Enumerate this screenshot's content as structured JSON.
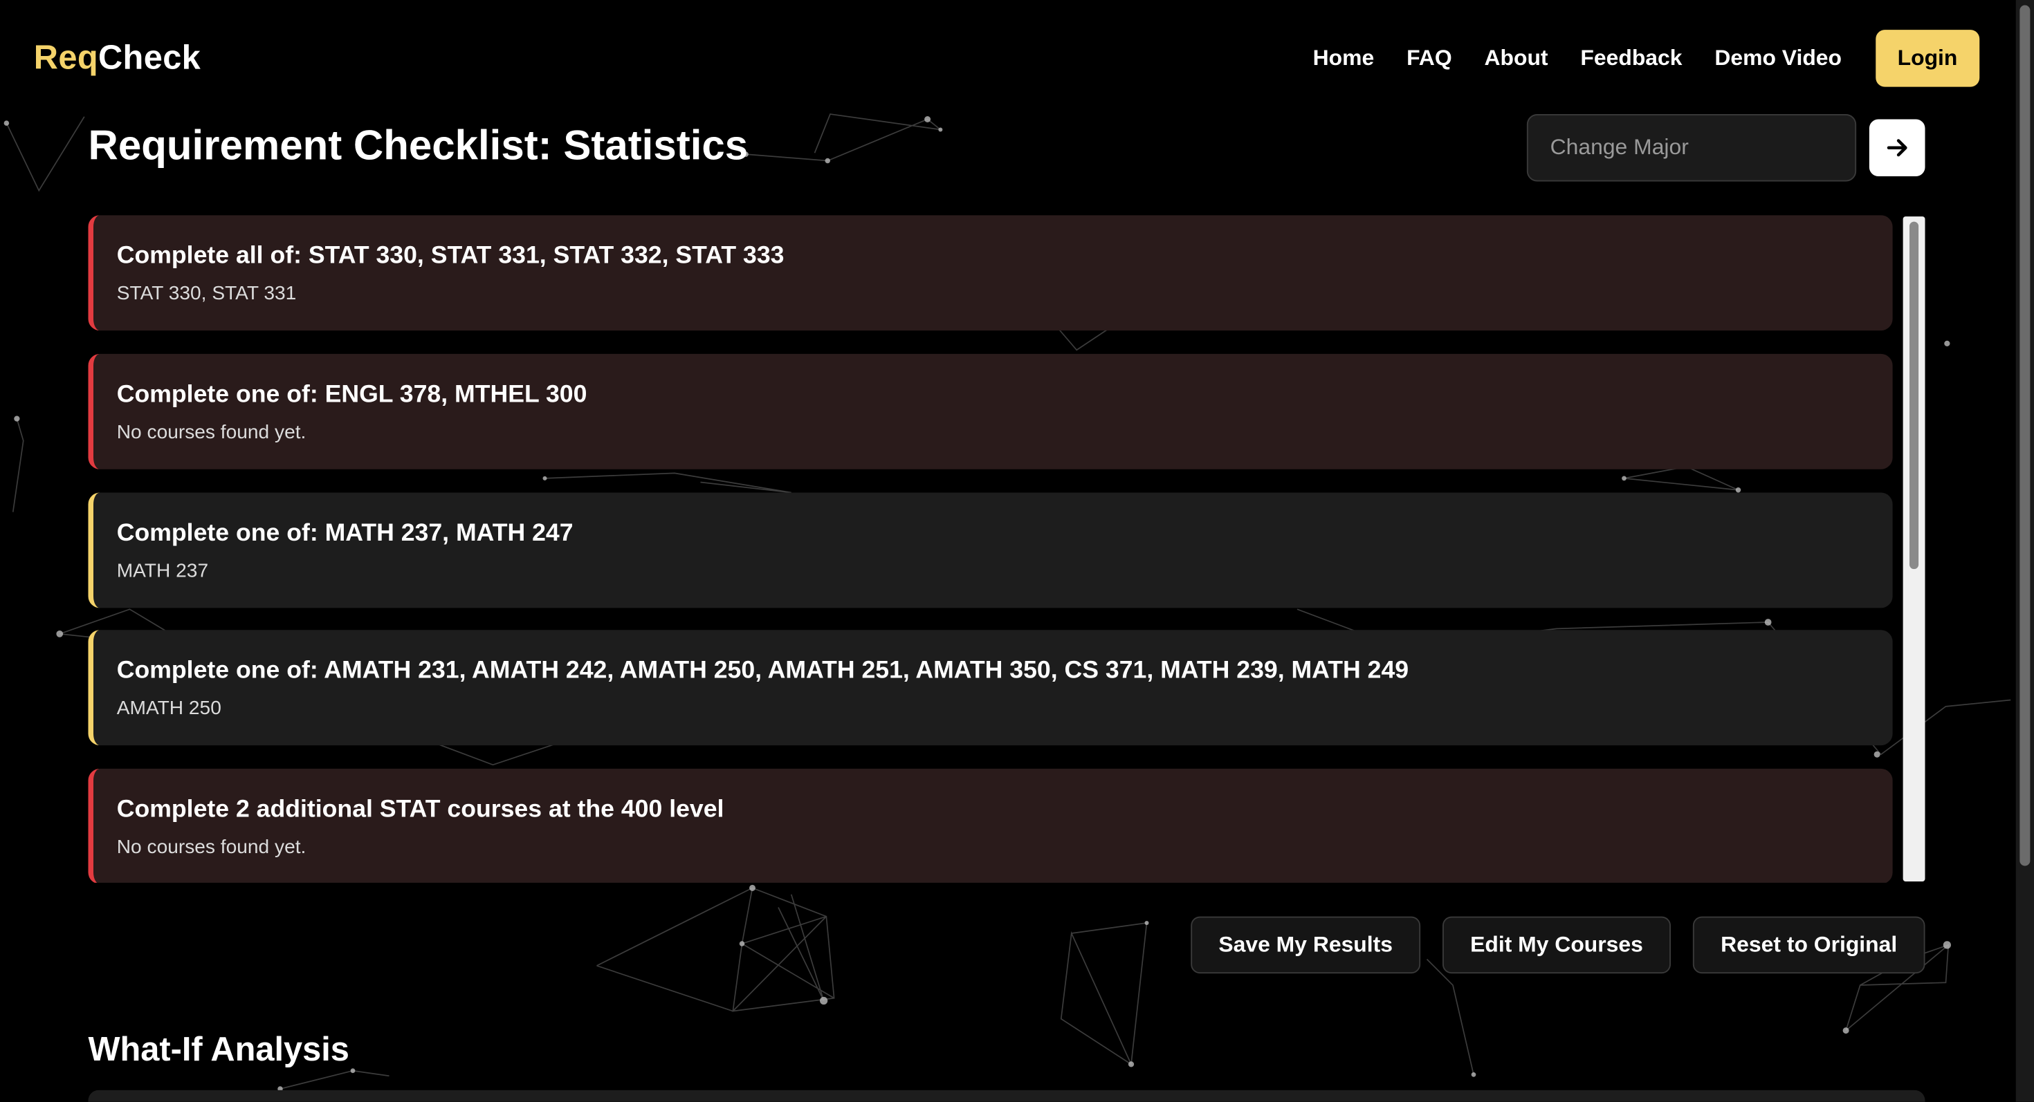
{
  "nav": {
    "logo_accent": "Req",
    "logo_rest": "Check",
    "links": [
      "Home",
      "FAQ",
      "About",
      "Feedback",
      "Demo Video"
    ],
    "login_label": "Login"
  },
  "header": {
    "title": "Requirement Checklist: Statistics",
    "major_placeholder": "Change Major",
    "go_icon": "arrow-right-icon"
  },
  "requirements": [
    {
      "title": "Complete all of: STAT 330, STAT 331, STAT 332, STAT 333",
      "courses": "STAT 330, STAT 331",
      "status": "missing"
    },
    {
      "title": "Complete one of: ENGL 378, MTHEL 300",
      "courses": "No courses found yet.",
      "status": "missing"
    },
    {
      "title": "Complete one of: MATH 237, MATH 247",
      "courses": "MATH 237",
      "status": "partial"
    },
    {
      "title": "Complete one of: AMATH 231, AMATH 242, AMATH 250, AMATH 251, AMATH 350, CS 371, MATH 239, MATH 249",
      "courses": "AMATH 250",
      "status": "partial"
    },
    {
      "title": "Complete 2 additional STAT courses at the 400 level",
      "courses": "No courses found yet.",
      "status": "missing"
    }
  ],
  "actions": {
    "save": "Save My Results",
    "edit": "Edit My Courses",
    "reset": "Reset to Original"
  },
  "whatif": {
    "title": "What-If Analysis"
  },
  "colors": {
    "accent": "#f5d36a",
    "missing_border": "#e23b40",
    "missing_bg": "#2a1b1b",
    "partial_border": "#f5d36a",
    "partial_bg": "#1d1d1d"
  }
}
